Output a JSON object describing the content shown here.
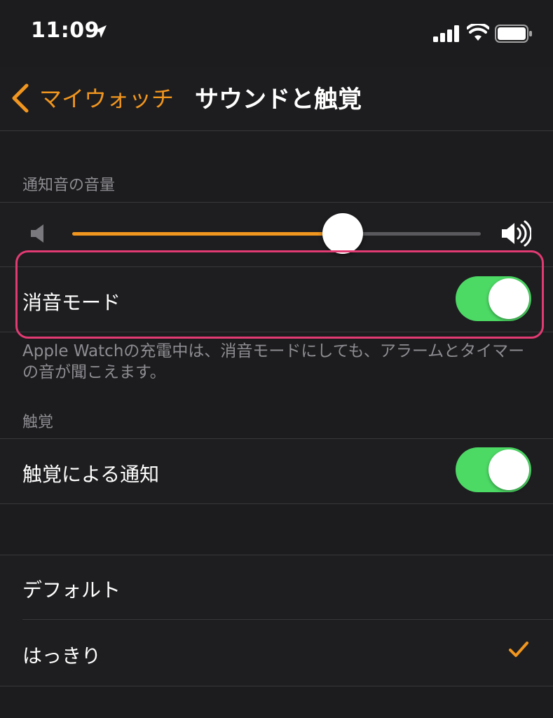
{
  "status_bar": {
    "time": "11:09",
    "icons": [
      "location-arrow-icon",
      "signal-icon",
      "wifi-icon",
      "battery-icon"
    ]
  },
  "nav": {
    "back_label": "マイウォッチ",
    "title": "サウンドと触覚"
  },
  "sections": {
    "notification_volume_header": "通知音の音量",
    "volume_level": 0.66,
    "silent_mode_label": "消音モード",
    "silent_mode_on": true,
    "silent_mode_footnote": "Apple Watchの充電中は、消音モードにしても、アラームとタイマーの音が聞こえます。",
    "haptics_header": "触覚",
    "haptic_alerts_label": "触覚による通知",
    "haptic_alerts_on": true,
    "haptic_options": [
      {
        "label": "デフォルト",
        "selected": false
      },
      {
        "label": "はっきり",
        "selected": true
      }
    ]
  },
  "colors": {
    "accent": "#f1961f",
    "toggle_on": "#4cd964",
    "highlight": "#e23a73",
    "background": "#1c1c1e"
  }
}
